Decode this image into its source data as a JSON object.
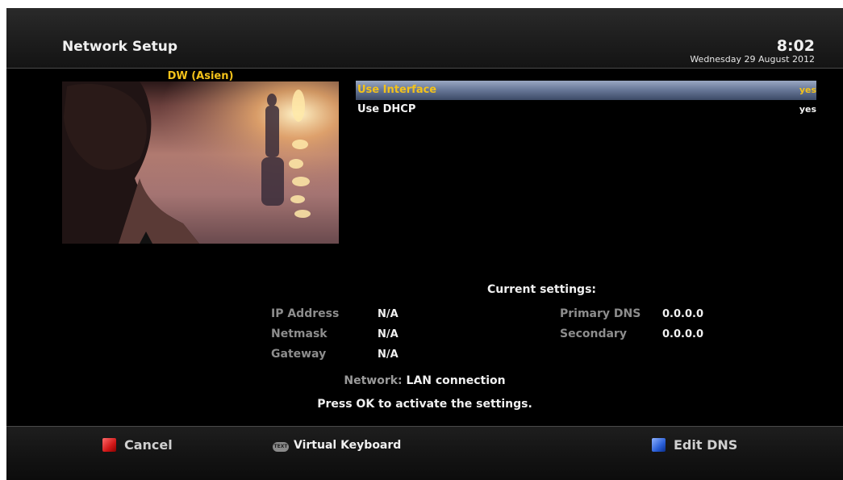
{
  "header": {
    "title": "Network Setup",
    "time": "8:02",
    "date": "Wednesday 29 August 2012"
  },
  "preview": {
    "channel": "DW (Asien)"
  },
  "settings_list": [
    {
      "label": "Use Interface",
      "value": "yes",
      "selected": true
    },
    {
      "label": "Use DHCP",
      "value": "yes",
      "selected": false
    }
  ],
  "current_settings": {
    "title": "Current settings:",
    "ip_label": "IP Address",
    "ip_value": "N/A",
    "netmask_label": "Netmask",
    "netmask_value": "N/A",
    "gateway_label": "Gateway",
    "gateway_value": "N/A",
    "primary_dns_label": "Primary DNS",
    "primary_dns_value": "0.0.0.0",
    "secondary_dns_label": "Secondary",
    "secondary_dns_value": "0.0.0.0",
    "network_label": "Network:",
    "network_value": "LAN connection",
    "hint": "Press OK to activate the settings."
  },
  "footer": {
    "cancel_label": "Cancel",
    "keyboard_icon_text": "TEXT",
    "keyboard_label": "Virtual Keyboard",
    "edit_dns_label": "Edit DNS"
  },
  "colors": {
    "background": "#000000",
    "selected_text": "#f3c21a",
    "selection_bar": "#6a7a9a",
    "red_key": "#d01818",
    "blue_key": "#2a5fd8"
  }
}
